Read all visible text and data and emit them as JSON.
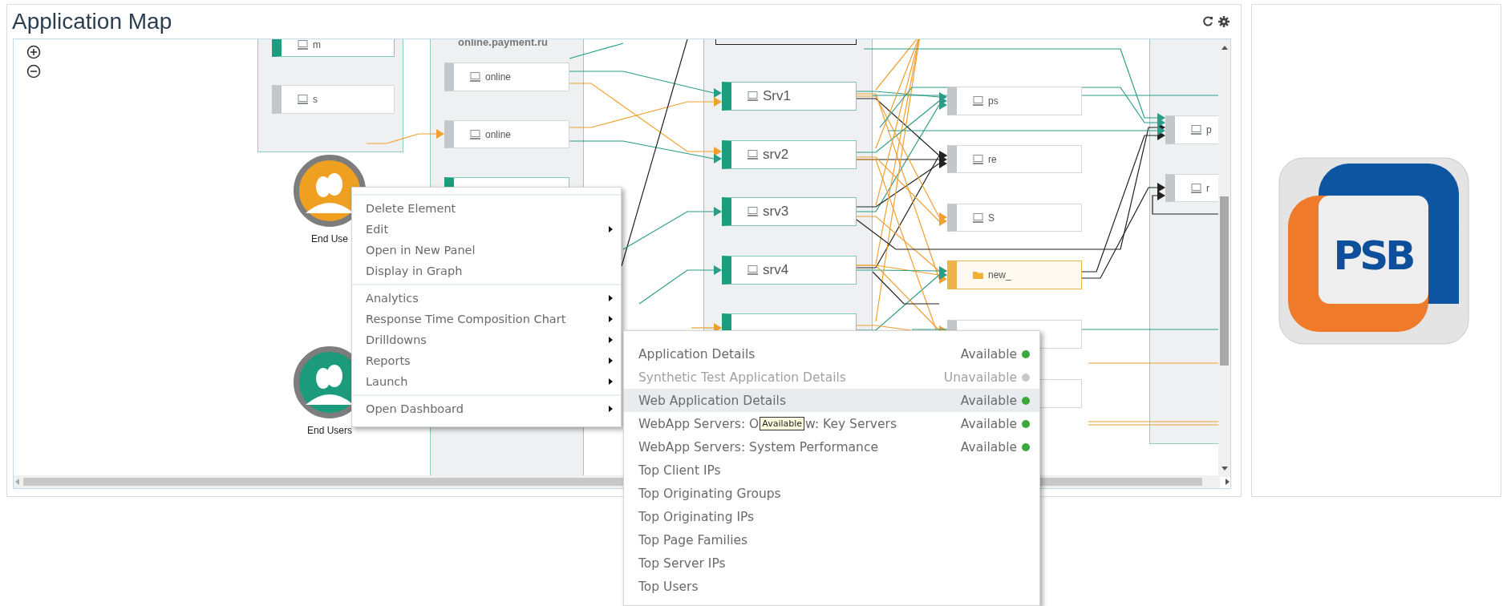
{
  "panel": {
    "title": "Application Map"
  },
  "map": {
    "group_title": "online.payment.ru",
    "nodes": [
      {
        "label": "m",
        "kind": "active"
      },
      {
        "label": "s",
        "kind": "inactive"
      },
      {
        "label": "online",
        "kind": "inactive"
      },
      {
        "label": "online",
        "kind": "inactive"
      },
      {
        "kind": "active"
      },
      {
        "label": "Srv1",
        "kind": "active"
      },
      {
        "label": "srv2",
        "kind": "active"
      },
      {
        "label": "srv3",
        "kind": "active"
      },
      {
        "label": "srv4",
        "kind": "active"
      },
      {
        "kind": "active"
      },
      {
        "label": "ps",
        "kind": "inactive"
      },
      {
        "label": "re",
        "kind": "inactive"
      },
      {
        "label": "S",
        "kind": "inactive"
      },
      {
        "label": "new_",
        "kind": "alert"
      },
      {
        "kind": "inactive"
      },
      {
        "kind": "inactive"
      },
      {
        "label": "p",
        "kind": "inactive"
      },
      {
        "label": "r",
        "kind": "inactive"
      }
    ],
    "end_users": [
      {
        "label": "End Use",
        "color": "#f0a020"
      },
      {
        "label": "End Users",
        "color": "#1b9a7c"
      }
    ]
  },
  "context_menu": {
    "sections": [
      [
        {
          "label": "Delete Element",
          "has_submenu": false
        },
        {
          "label": "Edit",
          "has_submenu": true
        },
        {
          "label": "Open in New Panel",
          "has_submenu": false
        },
        {
          "label": "Display in Graph",
          "has_submenu": false
        }
      ],
      [
        {
          "label": "Analytics",
          "has_submenu": true
        },
        {
          "label": "Response Time Composition Chart",
          "has_submenu": true
        },
        {
          "label": "Drilldowns",
          "has_submenu": true
        },
        {
          "label": "Reports",
          "has_submenu": true
        },
        {
          "label": "Launch",
          "has_submenu": true
        }
      ],
      [
        {
          "label": "Open Dashboard",
          "has_submenu": true
        }
      ]
    ]
  },
  "submenu": {
    "items": [
      {
        "label": "Application Details",
        "status": "Available",
        "disabled": false,
        "highlighted": false
      },
      {
        "label": "Synthetic Test Application Details",
        "status": "Unavailable",
        "disabled": true,
        "highlighted": false
      },
      {
        "label": "Web Application Details",
        "status": "Available",
        "disabled": false,
        "highlighted": true
      },
      {
        "label": "WebApp Servers: O",
        "tooltip": "Available",
        "label_rest": "w: Key Servers",
        "status": "Available",
        "disabled": false,
        "highlighted": false
      },
      {
        "label": "WebApp Servers: System Performance",
        "status": "Available",
        "disabled": false,
        "highlighted": false
      },
      {
        "label": "Top Client IPs",
        "disabled": false,
        "highlighted": false
      },
      {
        "label": "Top Originating Groups",
        "disabled": false,
        "highlighted": false
      },
      {
        "label": "Top Originating IPs",
        "disabled": false,
        "highlighted": false
      },
      {
        "label": "Top Page Families",
        "disabled": false,
        "highlighted": false
      },
      {
        "label": "Top Server IPs",
        "disabled": false,
        "highlighted": false
      },
      {
        "label": "Top Users",
        "disabled": false,
        "highlighted": false
      }
    ]
  },
  "logo": {
    "text": "PSB"
  }
}
